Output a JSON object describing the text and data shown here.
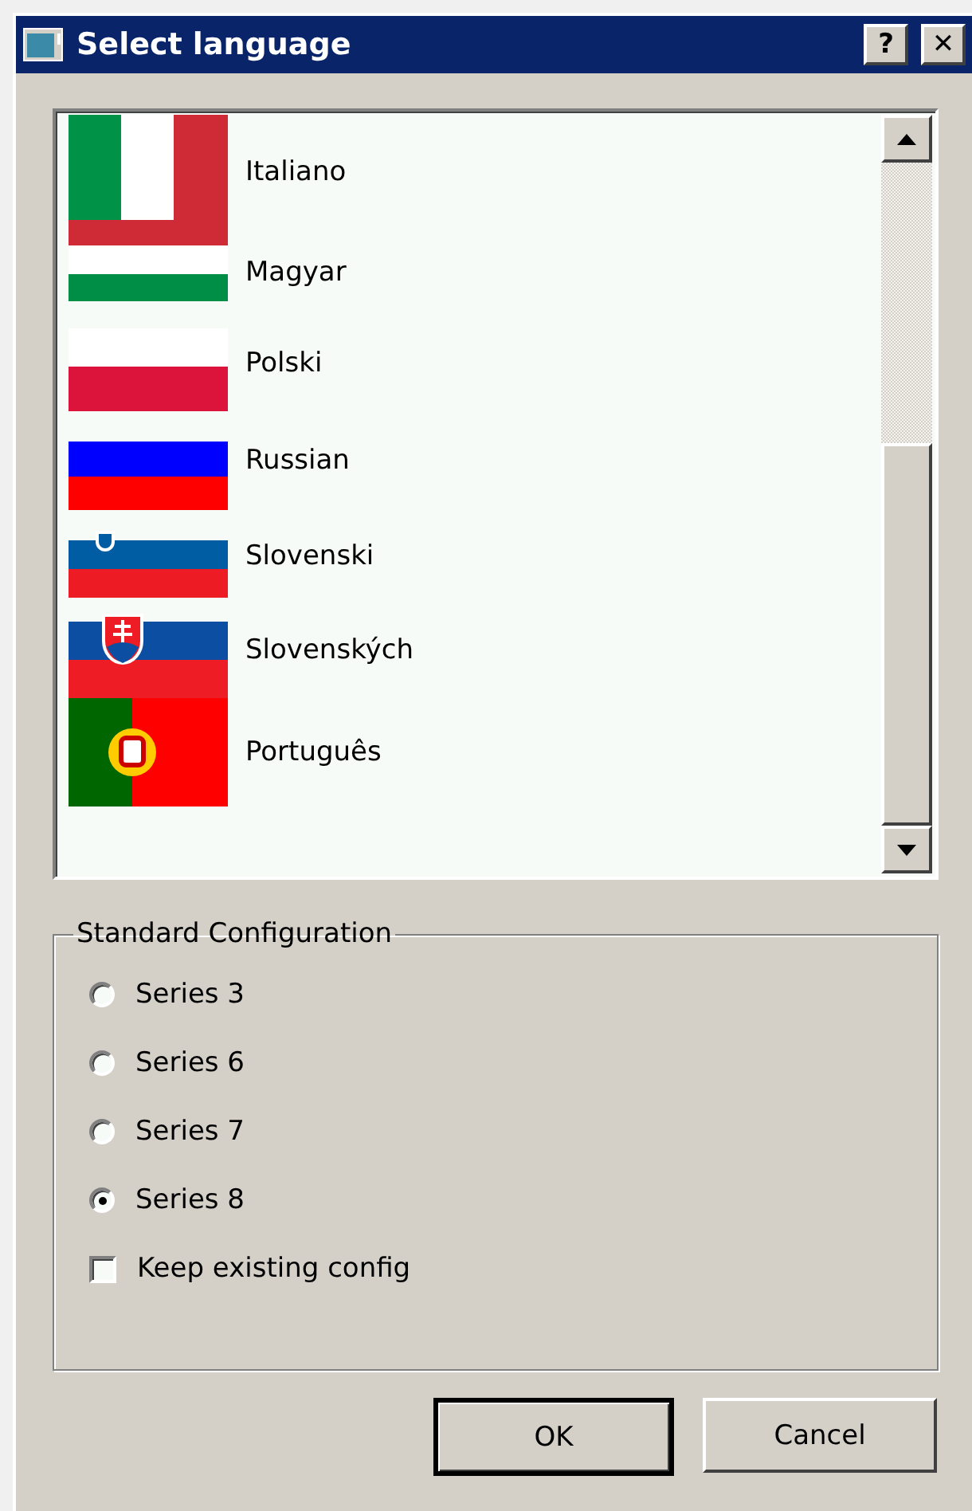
{
  "window": {
    "title": "Select language",
    "help_button": "?",
    "close_button": "✕"
  },
  "languages": [
    {
      "label": "Italiano"
    },
    {
      "label": "Magyar"
    },
    {
      "label": "Polski"
    },
    {
      "label": "Russian"
    },
    {
      "label": "Slovenski"
    },
    {
      "label": "Slovenských"
    },
    {
      "label": "Português"
    }
  ],
  "configuration": {
    "title": "Standard Configuration",
    "options": [
      {
        "label": "Series 3",
        "selected": false
      },
      {
        "label": "Series 6",
        "selected": false
      },
      {
        "label": "Series 7",
        "selected": false
      },
      {
        "label": "Series 8",
        "selected": true
      }
    ],
    "keep_existing": {
      "label": "Keep existing config",
      "checked": false
    }
  },
  "buttons": [
    {
      "label": "OK",
      "default": true
    },
    {
      "label": "Cancel",
      "default": false
    }
  ]
}
